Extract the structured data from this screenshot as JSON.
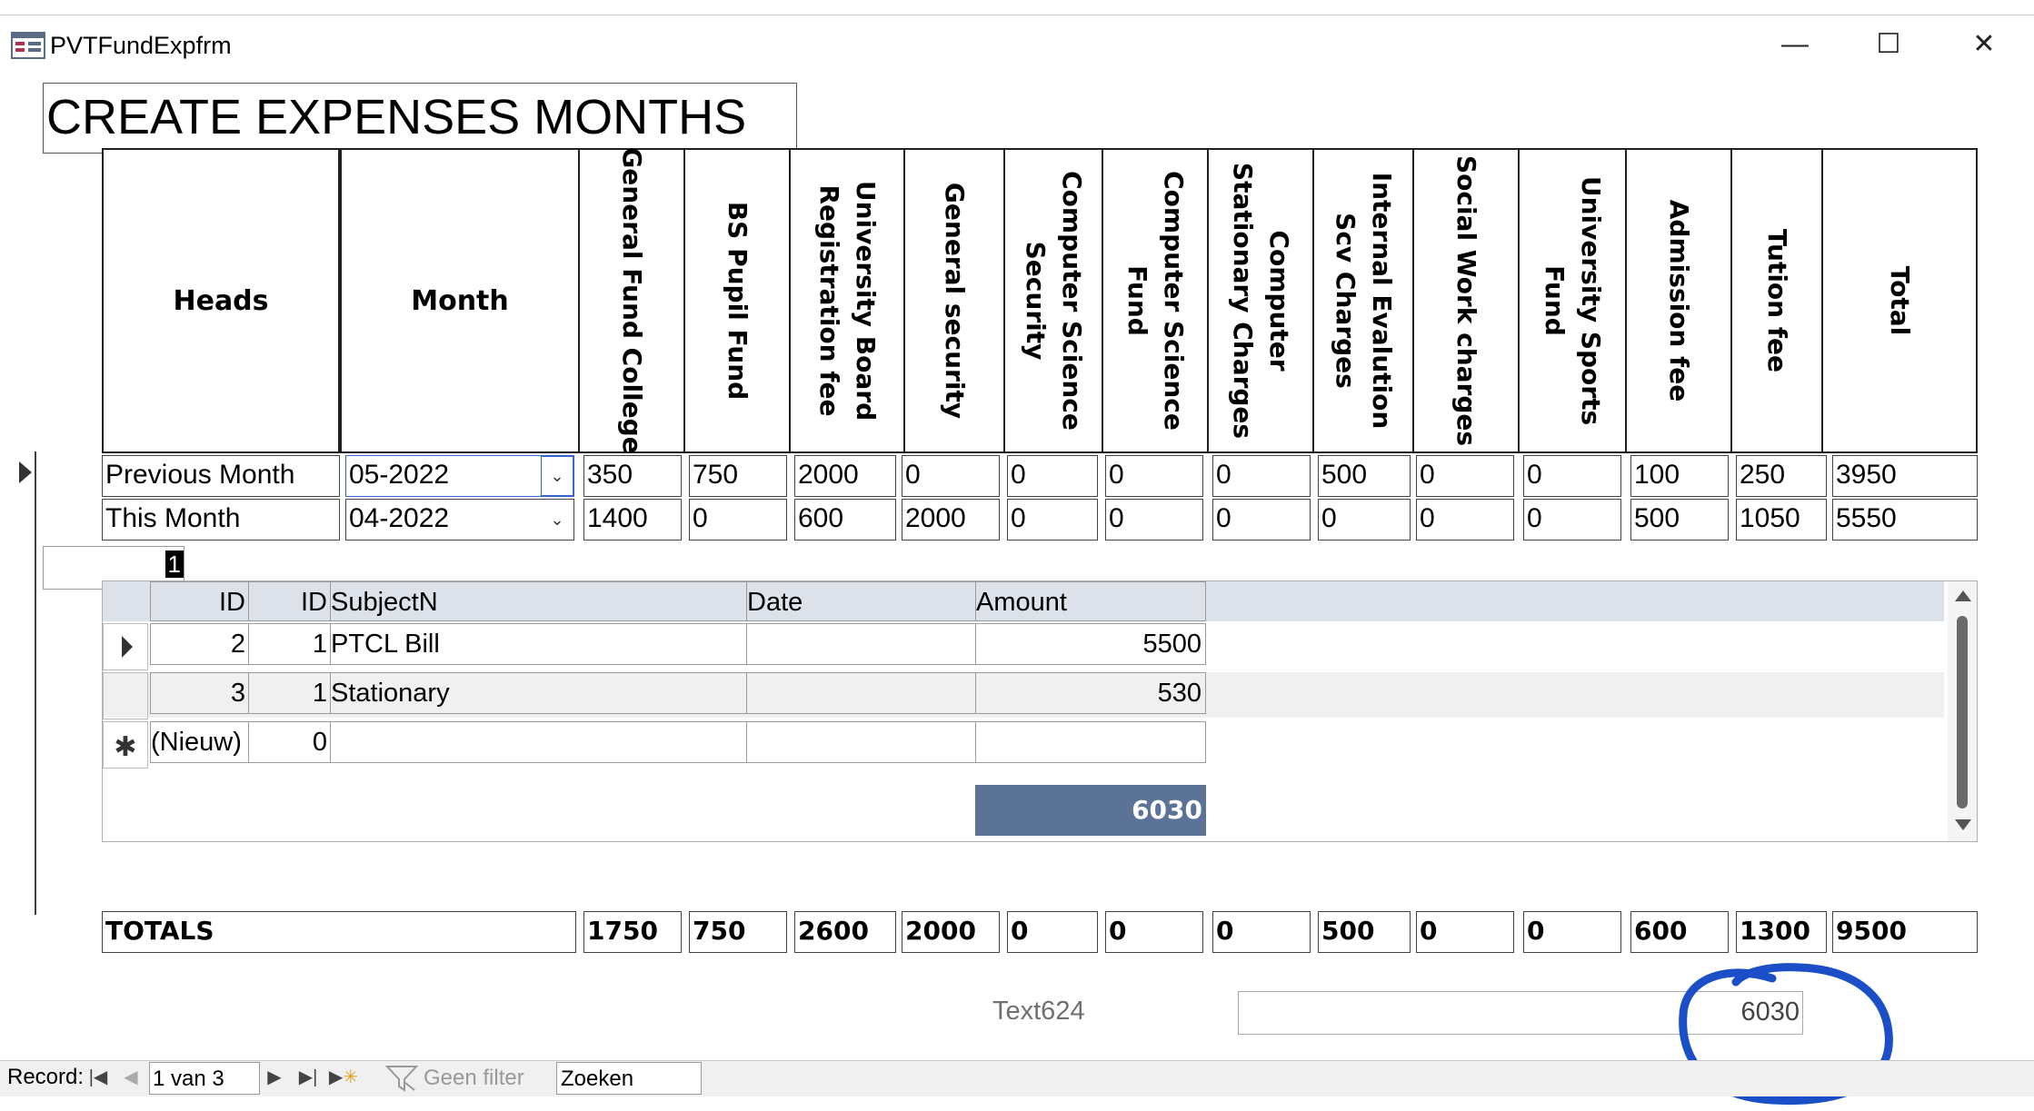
{
  "window": {
    "title": "PVTFundExpfrm",
    "controls": {
      "minimize": "—",
      "maximize": "☐",
      "close": "✕"
    }
  },
  "form": {
    "title": "CREATE EXPENSES MONTHS",
    "headers": {
      "heads": "Heads",
      "month": "Month",
      "vertical": [
        "General Fund College",
        "BS Pupil Fund",
        "University Board Registration fee",
        "General security",
        "Computer Science Security",
        "Computer Science Fund",
        "Computer Stationary Charges",
        "Internal Evalution Scv Charges",
        "Social Work charges",
        "University Sports Fund",
        "Admission fee",
        "Tution fee",
        "Total"
      ]
    },
    "rows": [
      {
        "head": "Previous Month",
        "month": "05-2022",
        "values": [
          "350",
          "750",
          "2000",
          "0",
          "0",
          "0",
          "0",
          "500",
          "0",
          "0",
          "100",
          "250",
          "3950"
        ]
      },
      {
        "head": "This Month",
        "month": "04-2022",
        "values": [
          "1400",
          "0",
          "600",
          "2000",
          "0",
          "0",
          "0",
          "0",
          "0",
          "0",
          "500",
          "1050",
          "5550"
        ]
      }
    ],
    "small_value": "1",
    "totals": {
      "label": "TOTALS",
      "values": [
        "1750",
        "750",
        "2600",
        "2000",
        "0",
        "0",
        "0",
        "500",
        "0",
        "0",
        "600",
        "1300",
        "9500"
      ]
    },
    "text624": {
      "label": "Text624",
      "value": "6030"
    }
  },
  "subform": {
    "columns": [
      "ID",
      "ID",
      "SubjectN",
      "Date",
      "Amount"
    ],
    "rows": [
      {
        "id": "2",
        "id2": "1",
        "subject": "PTCL Bill",
        "date": "",
        "amount": "5500"
      },
      {
        "id": "3",
        "id2": "1",
        "subject": "Stationary",
        "date": "",
        "amount": "530"
      }
    ],
    "new_row": {
      "id": "(Nieuw)",
      "id2": "0"
    },
    "sum": "6030"
  },
  "navigation": {
    "record_label": "Record:",
    "position": "1 van 3",
    "filter_label": "Geen filter",
    "search_placeholder": "Zoeken"
  },
  "colors": {
    "subform_header": "#dce1ea",
    "sum_fill": "#5a7397",
    "annotation": "#1a4fc8"
  }
}
